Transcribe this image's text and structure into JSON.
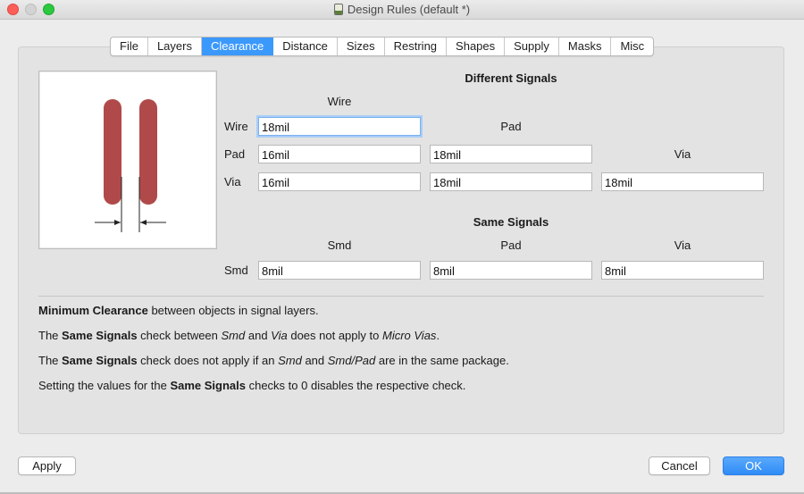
{
  "window": {
    "title": "Design Rules (default *)"
  },
  "tabs": [
    {
      "label": "File"
    },
    {
      "label": "Layers"
    },
    {
      "label": "Clearance",
      "active": true
    },
    {
      "label": "Distance"
    },
    {
      "label": "Sizes"
    },
    {
      "label": "Restring"
    },
    {
      "label": "Shapes"
    },
    {
      "label": "Supply"
    },
    {
      "label": "Masks"
    },
    {
      "label": "Misc"
    }
  ],
  "different_signals": {
    "heading": "Different Signals",
    "col_wire": "Wire",
    "col_pad": "Pad",
    "col_via": "Via",
    "row_wire": "Wire",
    "row_pad": "Pad",
    "row_via": "Via",
    "wire_wire": "18mil",
    "pad_wire": "16mil",
    "pad_pad": "18mil",
    "via_wire": "16mil",
    "via_pad": "18mil",
    "via_via": "18mil"
  },
  "same_signals": {
    "heading": "Same Signals",
    "col_smd": "Smd",
    "col_pad": "Pad",
    "col_via": "Via",
    "row_smd": "Smd",
    "smd_smd": "8mil",
    "smd_pad": "8mil",
    "smd_via": "8mil"
  },
  "notes": {
    "line1": {
      "b1": "Minimum Clearance",
      "t1": " between objects in signal layers."
    },
    "line2": {
      "t1": "The ",
      "b1": "Same Signals",
      "t2": " check between ",
      "i1": "Smd",
      "t3": " and ",
      "i2": "Via",
      "t4": " does not apply to ",
      "i3": "Micro Vias",
      "t5": "."
    },
    "line3": {
      "t1": "The ",
      "b1": "Same Signals",
      "t2": " check does not apply if an ",
      "i1": "Smd",
      "t3": " and ",
      "i2": "Smd/Pad",
      "t4": " are in the same package."
    },
    "line4": {
      "t1": "Setting the values for the ",
      "b1": "Same Signals",
      "t2": " checks to 0 disables the respective check."
    }
  },
  "buttons": {
    "apply": "Apply",
    "cancel": "Cancel",
    "ok": "OK"
  },
  "colors": {
    "accent": "#3b99fc",
    "trace": "#b04a4a"
  }
}
